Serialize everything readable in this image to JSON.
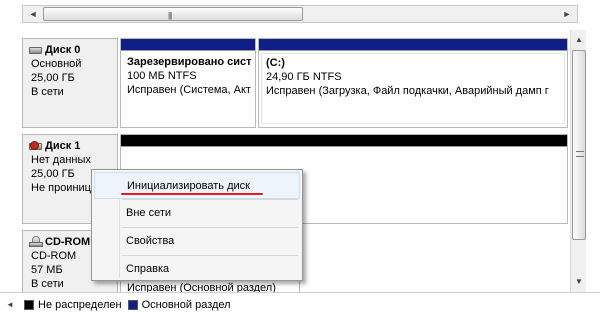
{
  "scroll": {
    "h_left_arrow": "◄",
    "h_right_arrow": "►",
    "h_grip": "|||",
    "v_up_arrow": "▲",
    "v_down_arrow": "▼"
  },
  "disks": [
    {
      "name": "Диск 0",
      "type": "Основной",
      "size": "25,00 ГБ",
      "status": "В сети",
      "partitions": [
        {
          "name": "Зарезервировано сист",
          "size": "100 МБ NTFS",
          "status": "Исправен (Система, Акт"
        },
        {
          "name": "(C:)",
          "size": "24,90 ГБ NTFS",
          "status": "Исправен (Загрузка, Файл подкачки, Аварийный дамп г"
        }
      ]
    },
    {
      "name": "Диск 1",
      "type": "Нет данных",
      "size": "25,00 ГБ",
      "status": "Не проиниц"
    },
    {
      "name": "CD-ROM",
      "type": "CD-ROM",
      "size": "57 МБ",
      "status": "В сети",
      "partition_status": "Исправен (Основной раздел)"
    }
  ],
  "context_menu": {
    "items": [
      "Инициализировать диск",
      "Вне сети",
      "Свойства",
      "Справка"
    ]
  },
  "legend": {
    "arrow": "◄",
    "items": [
      {
        "label": "Не распределен",
        "color": "#000000"
      },
      {
        "label": "Основной раздел",
        "color": "#0e1f86"
      }
    ]
  },
  "colors": {
    "primary_partition": "#0e1f86",
    "unallocated": "#000000",
    "annotation_underline": "#e02020"
  }
}
